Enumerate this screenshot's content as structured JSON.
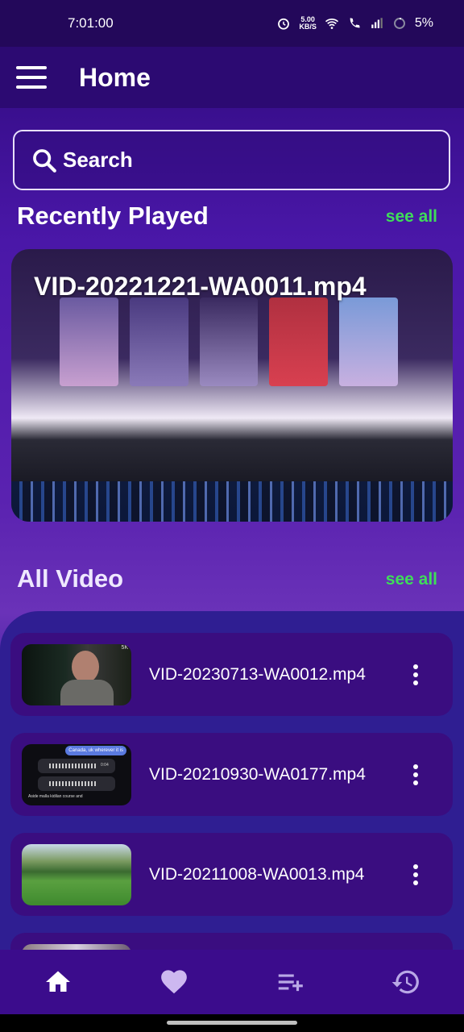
{
  "status_bar": {
    "time": "7:01:00",
    "network_speed_value": "5.00",
    "network_speed_unit": "KB/S",
    "battery": "5%"
  },
  "app_bar": {
    "title": "Home"
  },
  "search": {
    "label": "Search"
  },
  "recently_played": {
    "heading": "Recently Played",
    "see_all": "see all",
    "item": {
      "title": "VID-20221221-WA0011.mp4"
    }
  },
  "all_video": {
    "heading": "All Video",
    "see_all": "see all",
    "items": [
      {
        "name": "VID-20230713-WA0012.mp4"
      },
      {
        "name": "VID-20210930-WA0177.mp4"
      },
      {
        "name": "VID-20211008-WA0013.mp4"
      }
    ],
    "thumb_texts": {
      "item1_corner": "5K",
      "item2_message": "Canada, uk wherever it is",
      "item2_time": "0:04",
      "item2_caption": "Aside malla kidilan course and"
    }
  },
  "bottom_nav": {
    "icons": [
      "home-icon",
      "heart-icon",
      "playlist-add-icon",
      "history-icon"
    ],
    "active": "home-icon"
  },
  "colors": {
    "accent_see_all": "#3fdc5a",
    "app_bar": "#2c0a72",
    "card": "#3a0d80",
    "nav": "#3b0c8c"
  }
}
